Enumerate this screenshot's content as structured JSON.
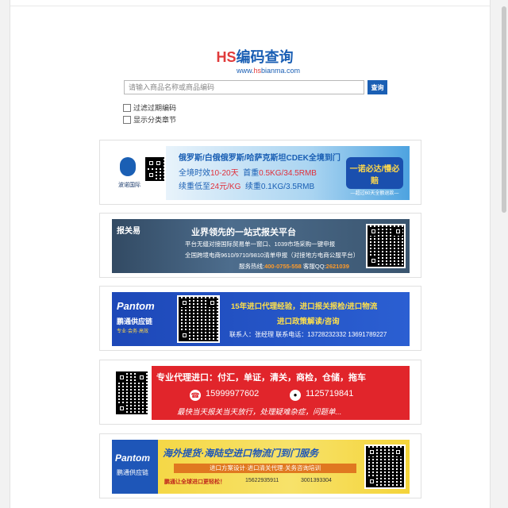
{
  "logo": {
    "hs": "HS",
    "cn": "编码查询"
  },
  "sublogo": {
    "pre": "www.",
    "hl": "hs",
    "post": "bianma.com"
  },
  "search": {
    "placeholder": "请输入商品名称或商品编码",
    "button": "查询"
  },
  "options": [
    {
      "label": "过滤过期编码",
      "checked": false
    },
    {
      "label": "显示分类章节",
      "checked": false
    }
  ],
  "ads": {
    "ad1": {
      "logo_text": "波诺国际",
      "title": "俄罗斯/白俄俄罗斯/哈萨克斯坦CDEK全境到门",
      "line2_a": "全境时效",
      "line2_b": "10-20天",
      "line2_c": "首重",
      "line2_d": "0.5KG/34.5RMB",
      "line3_a": "续重低至",
      "line3_b": "24元/KG",
      "line3_c": "续重0.1KG/3.5RMB",
      "promo1": "一诺必达/慢必赔",
      "promo2": "—超过60天全额退款—"
    },
    "ad2": {
      "logo_text": "报关易",
      "headline": "业界领先的一站式报关平台",
      "line1": "平台无缝对接国际贸易单一窗口、1039市场采购一键申报",
      "line2": "全国跨境电商9610/9710/9810清单申报（对接地方电商公服平台）",
      "hotline_label": "服务热线:",
      "hotline": "400-0755-558",
      "qq_label": "客服QQ:",
      "qq": "2621039"
    },
    "ad3": {
      "logo": "Pantom",
      "logo_cn": "鹏通供应链",
      "logo_sub": "专业·会务·高效",
      "line1": "15年进口代理经验，进口报关报检/进口物流",
      "line2": "进口政策解读/咨询",
      "line3": "联系人：张经理  联系电话：13728232332  13691789227"
    },
    "ad4": {
      "line1": "专业代理进口：付汇，单证，清关，商检，仓储，拖车",
      "phone": "15999977602",
      "qq": "1125719841",
      "line3": "最快当天报关当天放行，处理疑难杂症，问题单..."
    },
    "ad5": {
      "logo": "Pantom",
      "logo_cn": "鹏通供应链",
      "line1": "海外提货·海陆空进口物流门到门服务",
      "line2": "进口方案设计·进口清关代理·关务咨询培训",
      "line3": "鹏通让全球进口更轻松！",
      "contact1": "15622935911",
      "contact2": "3001393304"
    }
  }
}
